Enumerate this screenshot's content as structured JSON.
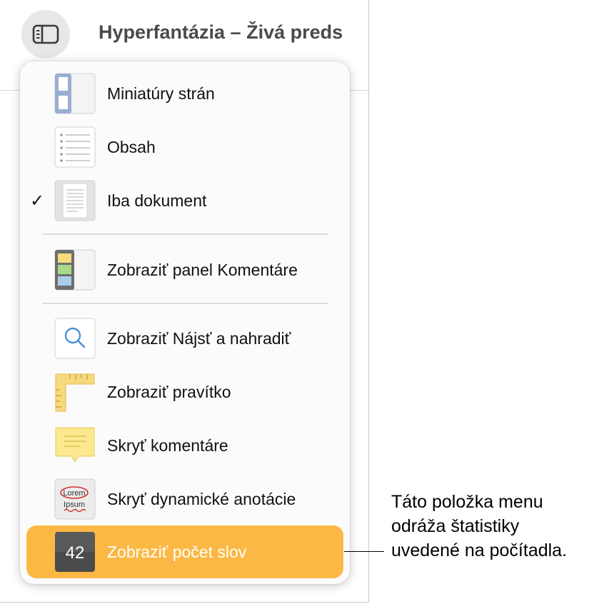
{
  "header": {
    "title": "Hyperfantázia – Živá preds",
    "view_button_icon": "sidebar-icon"
  },
  "menu": {
    "items": [
      {
        "label": "Miniatúry strán",
        "icon": "page-thumbnails-icon",
        "checked": false
      },
      {
        "label": "Obsah",
        "icon": "table-of-contents-icon",
        "checked": false
      },
      {
        "label": "Iba dokument",
        "icon": "document-only-icon",
        "checked": true,
        "check_mark": "✓"
      },
      {
        "label": "Zobraziť panel Komentáre",
        "icon": "comments-panel-icon",
        "checked": false
      },
      {
        "label": "Zobraziť Nájsť a nahradiť",
        "icon": "find-replace-icon",
        "checked": false
      },
      {
        "label": "Zobraziť pravítko",
        "icon": "ruler-icon",
        "checked": false
      },
      {
        "label": "Skryť komentáre",
        "icon": "comment-note-icon",
        "checked": false
      },
      {
        "label": "Skryť dynamické anotácie",
        "icon": "smart-annotation-icon",
        "checked": false,
        "icon_text": [
          "Lorem",
          "Ipsum"
        ]
      },
      {
        "label": "Zobraziť počet slov",
        "icon": "word-count-icon",
        "checked": false,
        "selected": true,
        "icon_text": "42"
      }
    ],
    "highlight_color": "#fcb844"
  },
  "callout": {
    "lines": [
      "Táto položka menu",
      "odráža štatistiky",
      "uvedené na počítadla."
    ]
  }
}
